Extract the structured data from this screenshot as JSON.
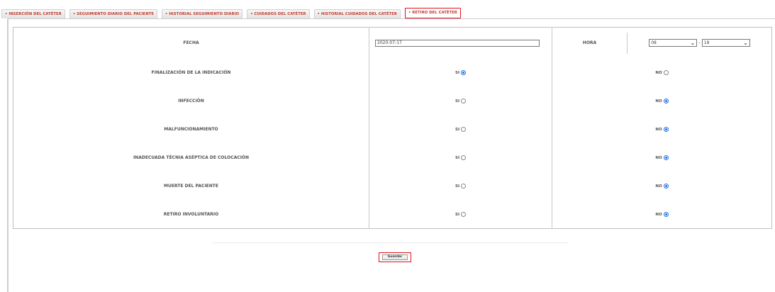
{
  "tabs": [
    {
      "label": "• INSERCIÓN DEL CATÉTER",
      "active": false
    },
    {
      "label": "• SEGUIMIENTO DIARIO DEL PACIENTE",
      "active": false
    },
    {
      "label": "• HISTORIAL SEGUIMIENTO DIARIO",
      "active": false
    },
    {
      "label": "• CUIDADOS DEL CATÉTER",
      "active": false
    },
    {
      "label": "• HISTORIAL CUIDADOS DEL CATÉTER",
      "active": false
    },
    {
      "label": "• RETIRO DEL CATÉTER",
      "active": true
    }
  ],
  "form": {
    "fecha_label": "FECHA",
    "fecha_value": "2020-07-17",
    "hora_label": "HORA",
    "hora_hour": "08",
    "hora_sep": "-",
    "hora_minute": "18",
    "rows": [
      {
        "label": "FINALIZACIÓN DE LA INDICACIÓN",
        "si_label": "SI",
        "no_label": "NO",
        "selected": "si"
      },
      {
        "label": "INFECCIÓN",
        "si_label": "SI",
        "no_label": "NO",
        "selected": "no"
      },
      {
        "label": "MALFUNCIONAMIENTO",
        "si_label": "SI",
        "no_label": "NO",
        "selected": "no"
      },
      {
        "label": "INADECUADA TÉCNIA ASÉPTICA DE COLOCACIÓN",
        "si_label": "SI",
        "no_label": "NO",
        "selected": "no"
      },
      {
        "label": "MUERTE DEL PACIENTE",
        "si_label": "SI",
        "no_label": "NO",
        "selected": "no"
      },
      {
        "label": "RETIRO INVOLUNTARIO",
        "si_label": "SI",
        "no_label": "NO",
        "selected": "no"
      }
    ]
  },
  "save_label": "Guardar"
}
